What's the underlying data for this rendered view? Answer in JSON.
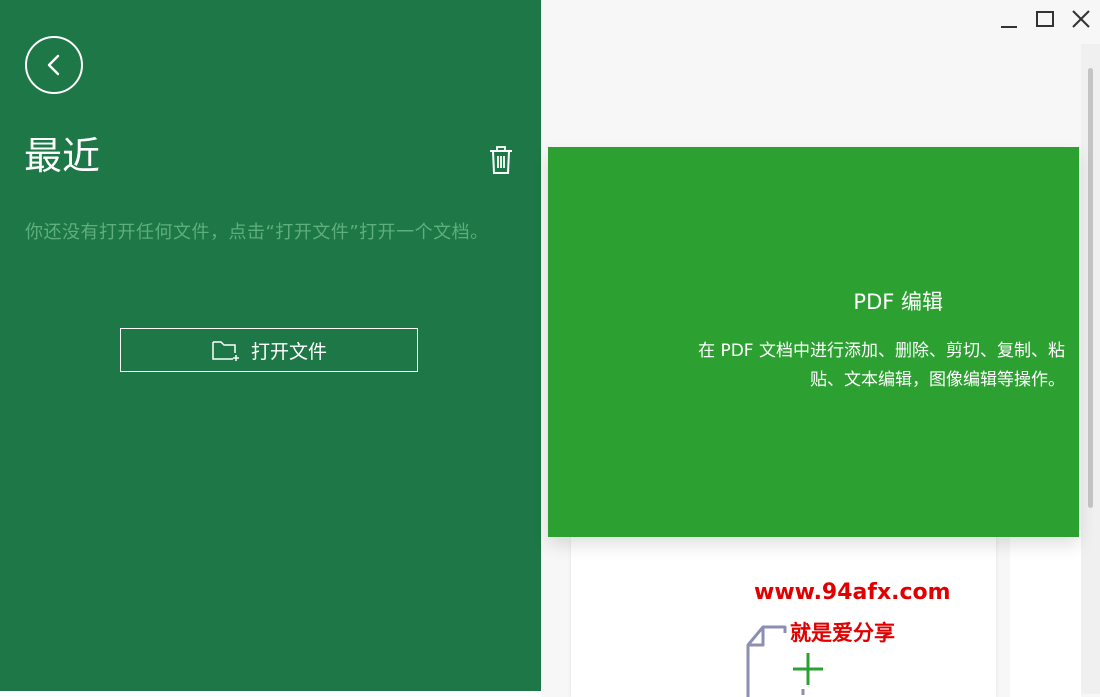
{
  "recent": {
    "title": "最近",
    "empty_message": "你还没有打开任何文件，点击“打开文件”打开一个文档。",
    "open_file_label": "打开文件"
  },
  "feature_card": {
    "title": "PDF 编辑",
    "description": "在 PDF 文档中进行添加、删除、剪切、复制、粘贴、文本编辑，图像编辑等操作。"
  },
  "watermark": {
    "url": "www.94afx.com",
    "slogan": "就是爱分享"
  },
  "icons": {
    "back": "back-arrow-icon",
    "trash": "trash-icon",
    "folder": "folder-plus-icon",
    "minimize": "minimize-icon",
    "maximize": "maximize-icon",
    "close": "close-icon",
    "new_document": "new-document-icon"
  },
  "colors": {
    "left_panel": "#1d7746",
    "feature_card": "#2ca132",
    "muted_text": "#5fae7e",
    "watermark": "#e00000"
  }
}
